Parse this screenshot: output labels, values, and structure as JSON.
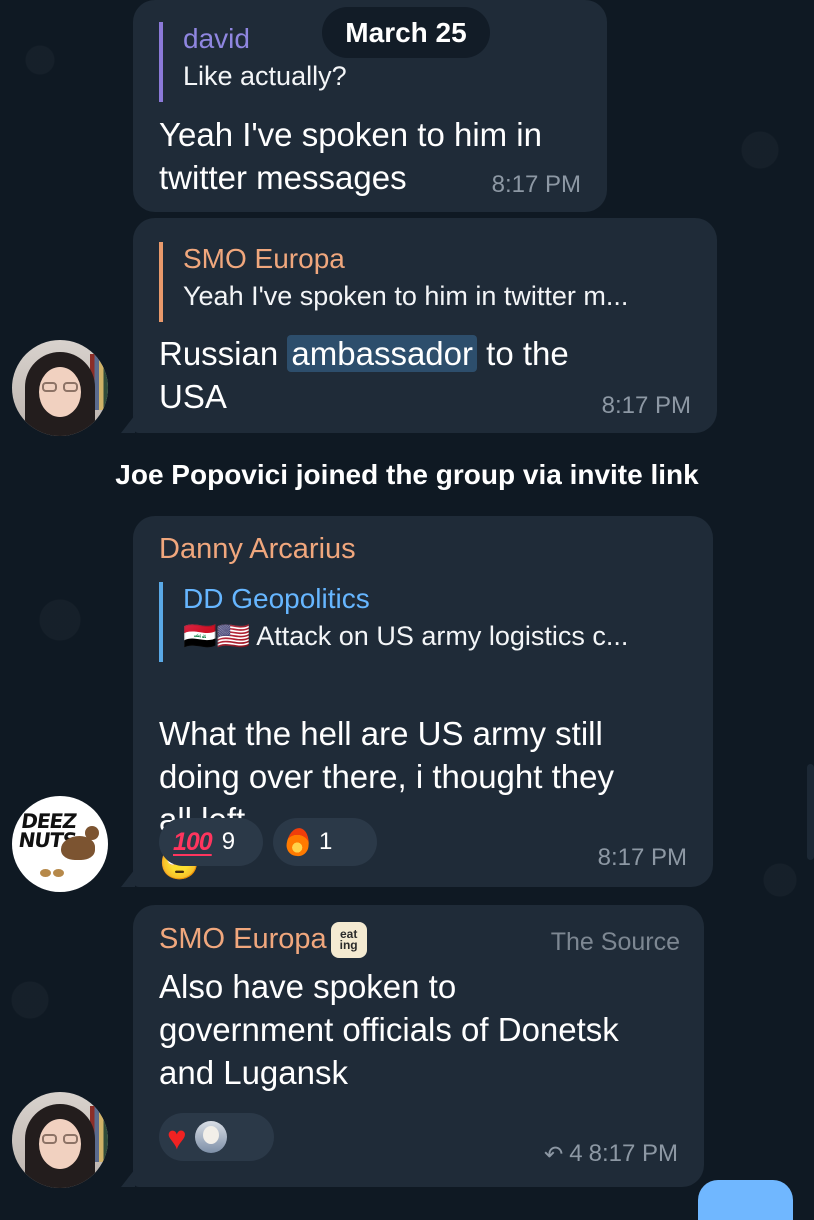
{
  "date_chip": "March 25",
  "service_message": "Joe Popovici joined the group via invite link",
  "messages": [
    {
      "reply": {
        "name": "david",
        "text": "Like actually?"
      },
      "text": "Yeah I've spoken to him in\ntwitter messages",
      "time": "8:17 PM"
    },
    {
      "reply": {
        "name": "SMO Europa",
        "text": "Yeah I've spoken to him in twitter m..."
      },
      "text_before": "Russian ",
      "highlight": "ambassador",
      "text_after": " to the\nUSA",
      "time": "8:17 PM",
      "avatar": "woman-glasses-avatar"
    },
    {
      "sender": "Danny Arcarius",
      "reply": {
        "name": "DD Geopolitics",
        "flags": "🇮🇶🇺🇸",
        "text": "Attack on US army logistics c..."
      },
      "text": "What the hell are US army still\ndoing over there, i thought they\nall left",
      "emoji": "🙄",
      "reactions": [
        {
          "icon": "100-icon",
          "count": "9"
        },
        {
          "icon": "fire-icon",
          "count": "1"
        }
      ],
      "time": "8:17 PM",
      "avatar_text": [
        "DEEZ",
        "NUTS"
      ]
    },
    {
      "sender": "SMO Europa",
      "badge": "eat\ning",
      "source": "The Source",
      "text": "Also have spoken to\ngovernment officials of Donetsk\nand Lugansk",
      "reactions": [
        {
          "icon": "heart-icon"
        },
        {
          "icon": "small-avatar-icon"
        }
      ],
      "forward_count": "4",
      "time": "8:17 PM",
      "avatar": "woman-glasses-avatar"
    }
  ]
}
